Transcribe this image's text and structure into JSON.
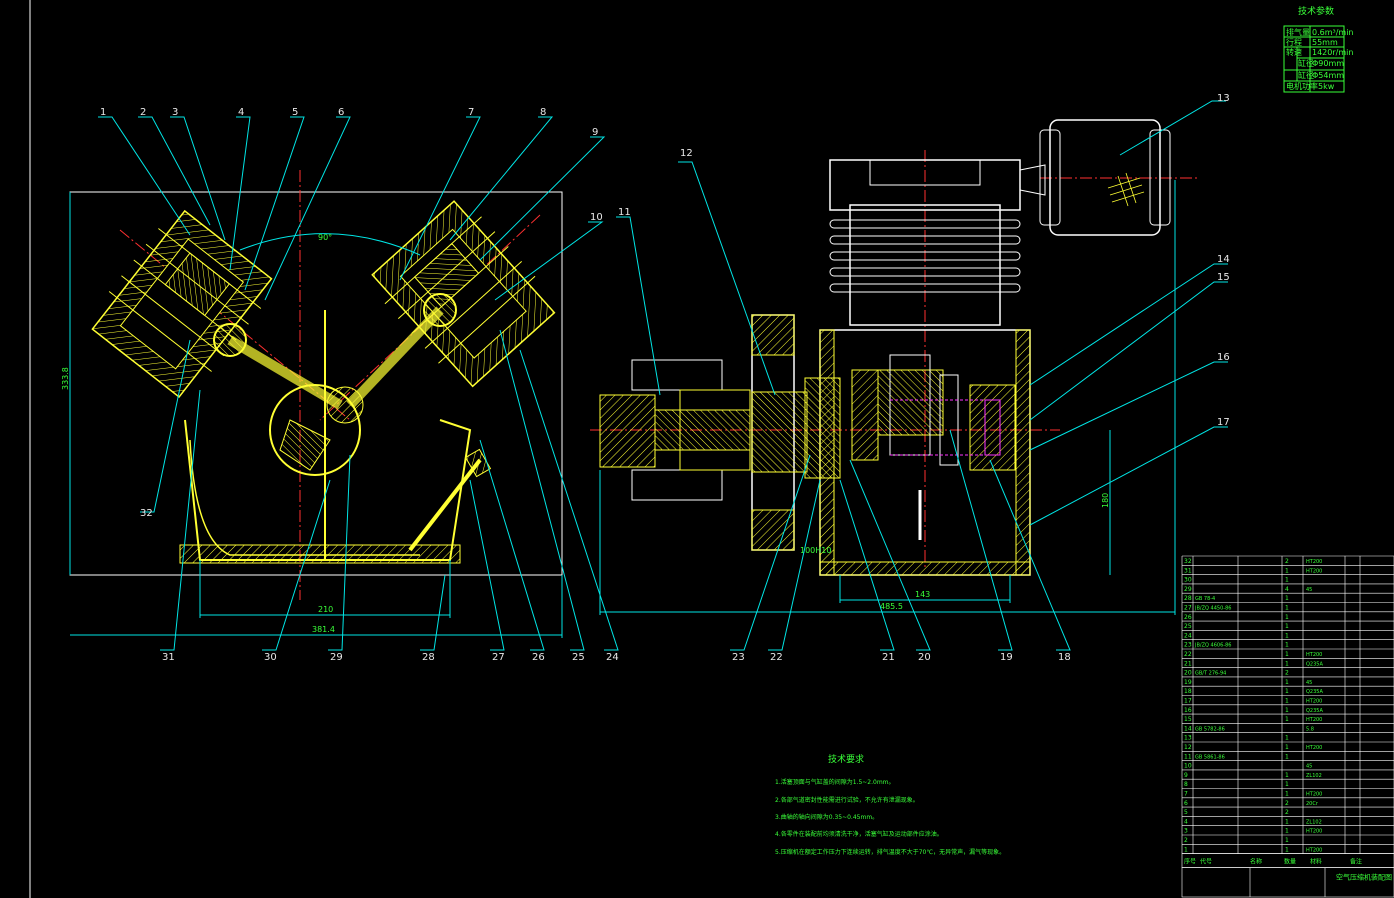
{
  "tech_params": {
    "title": "技术参数",
    "rows": [
      {
        "label": "排气量",
        "value": "0.6m³/min"
      },
      {
        "label": "行程",
        "value": "55mm"
      },
      {
        "label": "转速",
        "value": "1420r/min"
      },
      {
        "label": "缸径",
        "value": "Φ90mm"
      },
      {
        "label": "缸径",
        "value": "Φ54mm"
      },
      {
        "label": "电机功率",
        "value": "5kw"
      }
    ]
  },
  "balloons_left": [
    "1",
    "2",
    "3",
    "4",
    "5",
    "6",
    "7",
    "8",
    "9",
    "10",
    "32",
    "31",
    "30",
    "29",
    "28",
    "27",
    "26",
    "25",
    "24"
  ],
  "balloons_right": [
    "11",
    "12",
    "13",
    "14",
    "15",
    "16",
    "17",
    "23",
    "22",
    "21",
    "20",
    "19",
    "18"
  ],
  "dims": {
    "angle": "90°",
    "left_height": "333.8",
    "left_w1": "210",
    "left_w2": "381.4",
    "right_w1": "143",
    "right_w2": "485.5",
    "right_h": "180",
    "right_small": "100H10"
  },
  "notes": {
    "title": "技术要求",
    "items": [
      "1.活塞顶面与气缸盖的间隙为1.5~2.0mm。",
      "2.各部气道密封性能需进行试验，不允许有泄漏现象。",
      "3.曲轴的轴向间隙为0.35~0.45mm。",
      "4.各零件在装配前均须清洗干净，活塞气缸及运动部件应涂油。",
      "5.压缩机在额定工作压力下连续运转，排气温度不大于70℃，无异常声，漏气等现象。"
    ]
  },
  "bom": {
    "rows": [
      {
        "no": "32",
        "code": "",
        "name": "",
        "qty": "2",
        "mat": "HT200"
      },
      {
        "no": "31",
        "code": "",
        "name": "",
        "qty": "1",
        "mat": "HT200"
      },
      {
        "no": "30",
        "code": "",
        "name": "",
        "qty": "1",
        "mat": ""
      },
      {
        "no": "29",
        "code": "",
        "name": "",
        "qty": "4",
        "mat": "45"
      },
      {
        "no": "28",
        "code": "GB 78-4",
        "name": "",
        "qty": "1",
        "mat": ""
      },
      {
        "no": "27",
        "code": "JB/ZQ 4450-86",
        "name": "",
        "qty": "1",
        "mat": ""
      },
      {
        "no": "26",
        "code": "",
        "name": "",
        "qty": "1",
        "mat": ""
      },
      {
        "no": "25",
        "code": "",
        "name": "",
        "qty": "1",
        "mat": ""
      },
      {
        "no": "24",
        "code": "",
        "name": "",
        "qty": "1",
        "mat": ""
      },
      {
        "no": "23",
        "code": "JB/ZQ 4606-86",
        "name": "",
        "qty": "1",
        "mat": ""
      },
      {
        "no": "22",
        "code": "",
        "name": "",
        "qty": "1",
        "mat": "HT200"
      },
      {
        "no": "21",
        "code": "",
        "name": "",
        "qty": "1",
        "mat": "Q235A"
      },
      {
        "no": "20",
        "code": "GB/T 276-94",
        "name": "",
        "qty": "2",
        "mat": ""
      },
      {
        "no": "19",
        "code": "",
        "name": "",
        "qty": "1",
        "mat": "45"
      },
      {
        "no": "18",
        "code": "",
        "name": "",
        "qty": "1",
        "mat": "Q235A"
      },
      {
        "no": "17",
        "code": "",
        "name": "",
        "qty": "1",
        "mat": "HT200"
      },
      {
        "no": "16",
        "code": "",
        "name": "",
        "qty": "1",
        "mat": "Q235A"
      },
      {
        "no": "15",
        "code": "",
        "name": "",
        "qty": "1",
        "mat": "HT200"
      },
      {
        "no": "14",
        "code": "GB 5782-86",
        "name": "",
        "qty": "",
        "mat": "5.8"
      },
      {
        "no": "13",
        "code": "",
        "name": "",
        "qty": "1",
        "mat": ""
      },
      {
        "no": "12",
        "code": "",
        "name": "",
        "qty": "1",
        "mat": "HT200"
      },
      {
        "no": "11",
        "code": "GB 5861-86",
        "name": "",
        "qty": "1",
        "mat": ""
      },
      {
        "no": "10",
        "code": "",
        "name": "",
        "qty": "",
        "mat": "45"
      },
      {
        "no": "9",
        "code": "",
        "name": "",
        "qty": "1",
        "mat": "ZL102"
      },
      {
        "no": "8",
        "code": "",
        "name": "",
        "qty": "1",
        "mat": ""
      },
      {
        "no": "7",
        "code": "",
        "name": "",
        "qty": "1",
        "mat": "HT200"
      },
      {
        "no": "6",
        "code": "",
        "name": "",
        "qty": "2",
        "mat": "20Cr"
      },
      {
        "no": "5",
        "code": "",
        "name": "",
        "qty": "2",
        "mat": ""
      },
      {
        "no": "4",
        "code": "",
        "name": "",
        "qty": "1",
        "mat": "ZL102"
      },
      {
        "no": "3",
        "code": "",
        "name": "",
        "qty": "1",
        "mat": "HT200"
      },
      {
        "no": "2",
        "code": "",
        "name": "",
        "qty": "1",
        "mat": ""
      },
      {
        "no": "1",
        "code": "",
        "name": "",
        "qty": "1",
        "mat": "HT200"
      }
    ],
    "header": [
      "序号",
      "代号",
      "名称",
      "数量",
      "材料",
      "备注"
    ],
    "title_block": "空气压缩机装配图"
  },
  "colors": {
    "bg": "#000000",
    "line": "#ffffff",
    "cyan": "#00e5e5",
    "yellow": "#ffff33",
    "green": "#39ff39",
    "red": "#ff3030",
    "magenta": "#ff33ff"
  }
}
